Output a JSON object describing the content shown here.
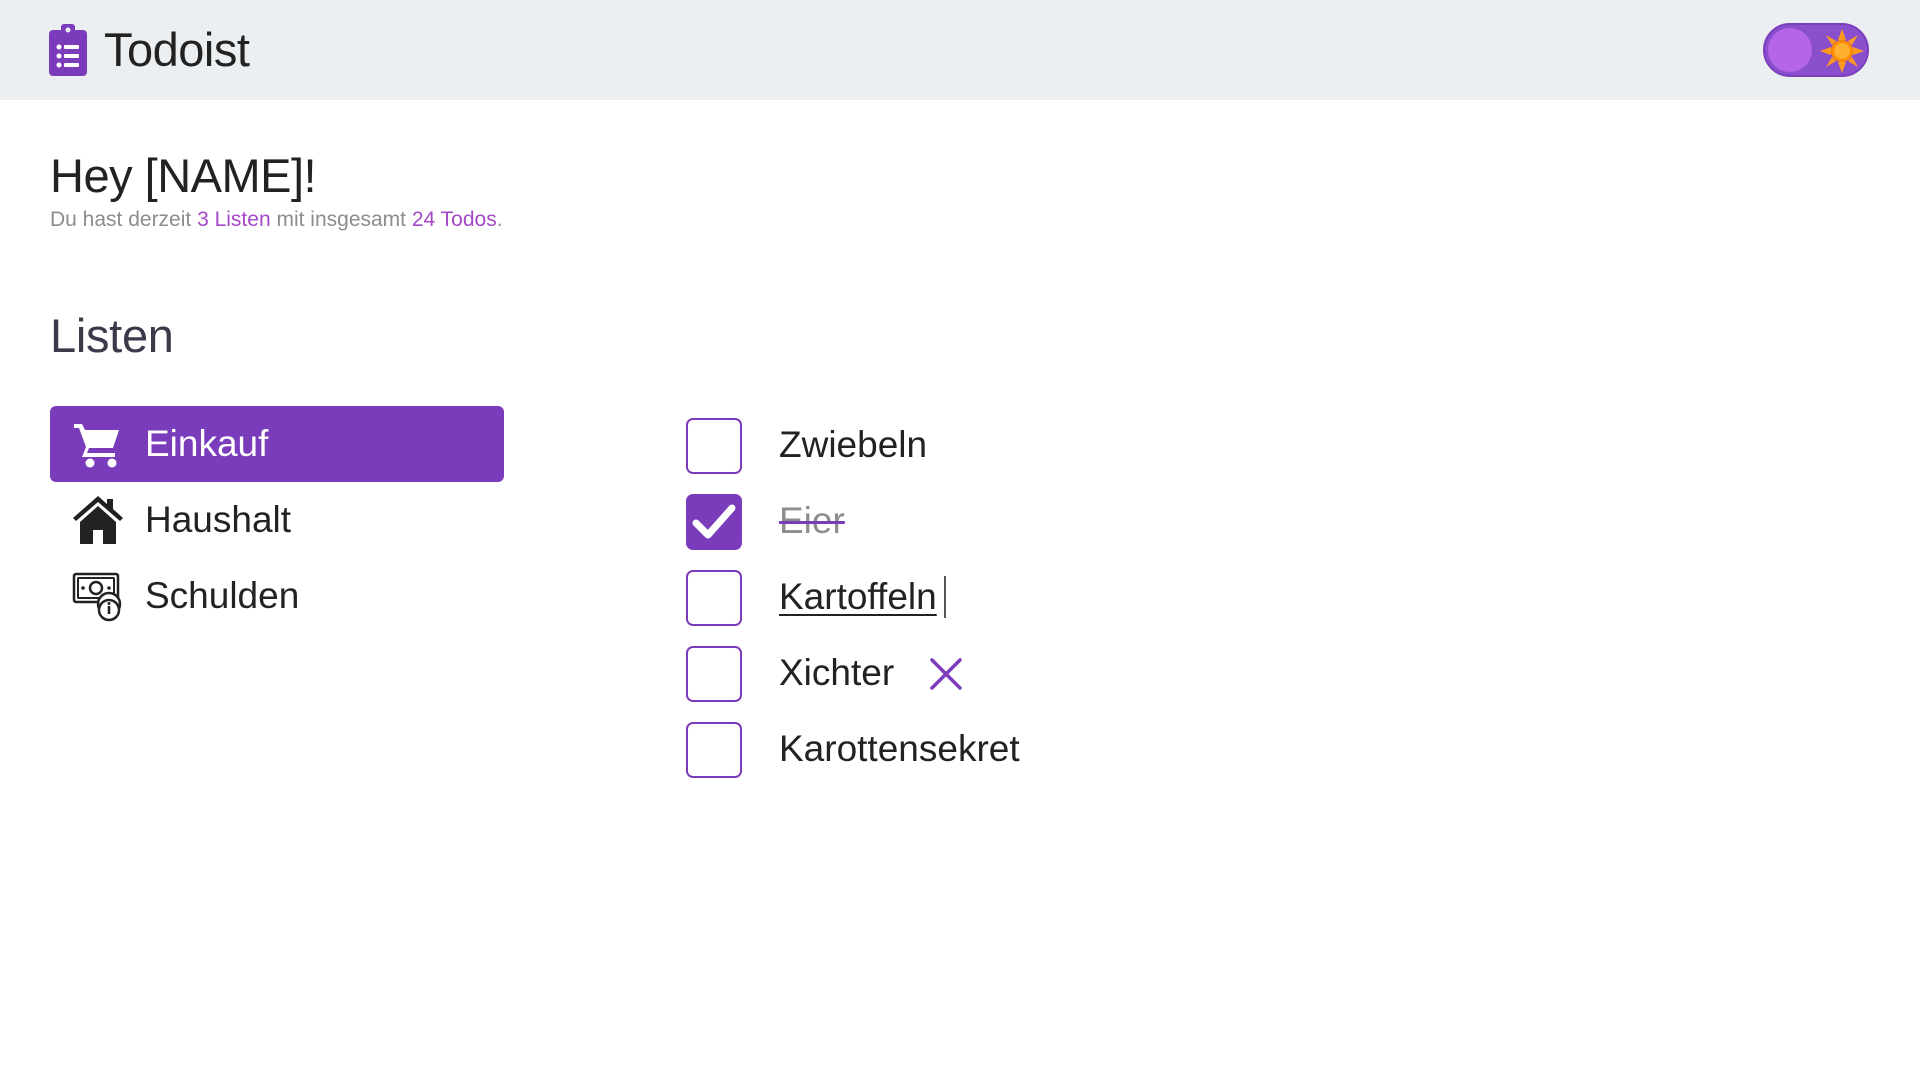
{
  "header": {
    "app_title": "Todoist",
    "logo_icon": "clipboard-list-icon",
    "theme_toggle": {
      "state": "light",
      "icon": "sun-icon",
      "accent": "#8a4fcc"
    }
  },
  "greeting": {
    "title": "Hey [NAME]!",
    "summary_prefix": "Du hast derzeit ",
    "list_count_text": "3 Listen",
    "summary_middle": " mit insgesamt ",
    "todo_count_text": "24 Todos",
    "summary_suffix": "."
  },
  "lists_section": {
    "title": "Listen",
    "items": [
      {
        "label": "Einkauf",
        "icon": "shopping-cart-icon",
        "active": true
      },
      {
        "label": "Haushalt",
        "icon": "house-icon",
        "active": false
      },
      {
        "label": "Schulden",
        "icon": "money-bill-icon",
        "active": false
      }
    ]
  },
  "todos": {
    "items": [
      {
        "text": "Zwiebeln",
        "checked": false
      },
      {
        "text": "Eier",
        "checked": true
      },
      {
        "text": "Kartoffeln",
        "checked": false,
        "editing": true
      },
      {
        "text": "Xichter",
        "checked": false,
        "hover_delete": true
      },
      {
        "text": "Karottensekret",
        "checked": false
      }
    ]
  },
  "colors": {
    "accent": "#7b3cbb",
    "accent_light": "#a349c8",
    "header_bg": "#eceff1",
    "muted_text": "#8d8d8d"
  }
}
